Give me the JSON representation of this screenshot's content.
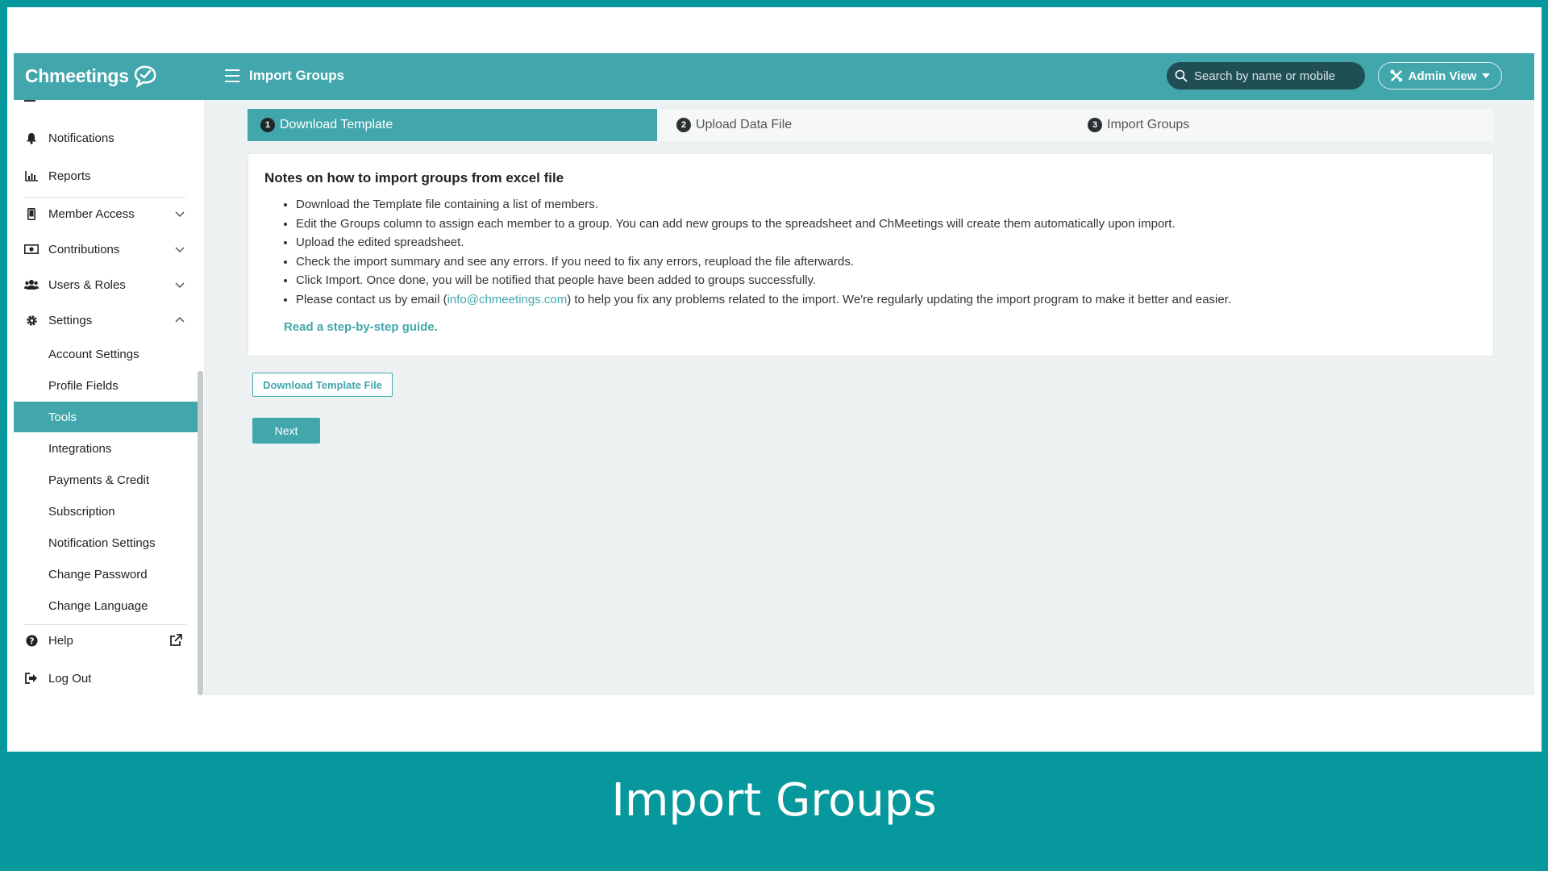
{
  "app": {
    "logo": "Chmeetings",
    "page_title": "Import Groups"
  },
  "header": {
    "search_placeholder": "Search by name or mobile",
    "admin_view_label": "Admin View"
  },
  "sidebar": {
    "items": [
      {
        "label": "Notifications",
        "icon": "bell-icon"
      },
      {
        "label": "Reports",
        "icon": "bar-chart-icon"
      },
      {
        "label": "Member Access",
        "icon": "mobile-icon"
      },
      {
        "label": "Contributions",
        "icon": "money-icon"
      },
      {
        "label": "Users & Roles",
        "icon": "users-icon"
      },
      {
        "label": "Settings",
        "icon": "gear-icon"
      }
    ],
    "settings_sub": [
      "Account Settings",
      "Profile Fields",
      "Tools",
      "Integrations",
      "Payments & Credit",
      "Subscription",
      "Notification Settings",
      "Change Password",
      "Change Language"
    ],
    "active_sub": "Tools",
    "help": "Help",
    "logout": "Log Out"
  },
  "steps": [
    {
      "number": "1",
      "label": "Download Template",
      "active": true
    },
    {
      "number": "2",
      "label": "Upload Data File",
      "active": false
    },
    {
      "number": "3",
      "label": "Import Groups",
      "active": false
    }
  ],
  "notes": {
    "title": "Notes on how to import groups from excel file",
    "bullets": [
      "Download the Template file containing a list of members.",
      "Edit the Groups column to assign each member to a group. You can add new groups to the spreadsheet and ChMeetings will create them automatically upon import.",
      "Upload the edited spreadsheet.",
      "Check the import summary and see any errors. If you need to fix any errors, reupload the file afterwards.",
      "Click Import. Once done, you will be notified that people have been added to groups successfully."
    ],
    "contact_prefix": "Please contact us by email (",
    "contact_email": "info@chmeetings.com",
    "contact_suffix": ") to help you fix any problems related to the import. We're regularly updating the import program to make it better and easier.",
    "guide_link": "Read a step-by-step guide."
  },
  "buttons": {
    "download_template": "Download Template File",
    "next": "Next"
  },
  "caption": "Import Groups",
  "colors": {
    "accent": "#41a7ac",
    "frame": "#06989c",
    "search_bg": "#1f4f55"
  }
}
